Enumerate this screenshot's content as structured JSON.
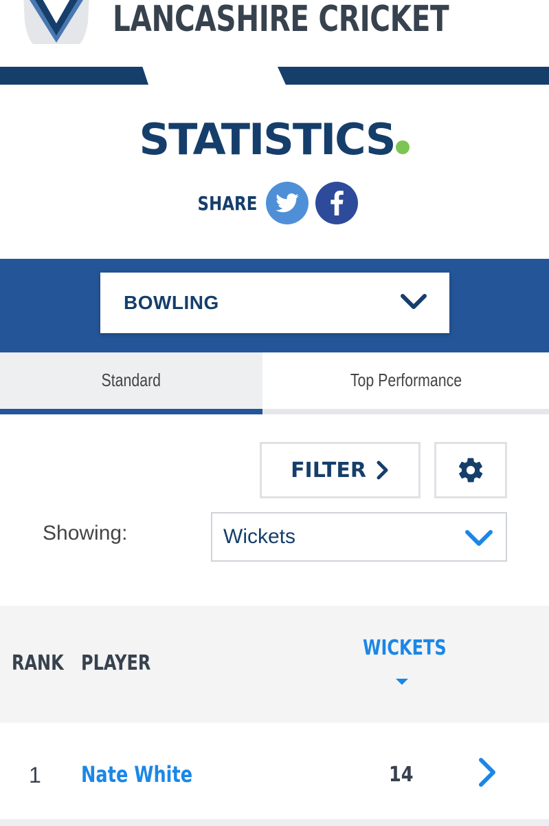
{
  "header": {
    "brand": "LANCASHIRE CRICKET",
    "logo_icon": "cricket-shirt-icon"
  },
  "page": {
    "title": "STATISTICS",
    "accent_dot_color": "#7cc552"
  },
  "share": {
    "label": "SHARE",
    "twitter_icon": "twitter-icon",
    "facebook_icon": "facebook-icon"
  },
  "category_select": {
    "value": "BOWLING"
  },
  "tabs": [
    {
      "label": "Standard",
      "active": true
    },
    {
      "label": "Top Performance",
      "active": false
    }
  ],
  "toolbar": {
    "filter_label": "FILTER",
    "settings_icon": "gear-icon"
  },
  "showing": {
    "label": "Showing:",
    "value": "Wickets"
  },
  "table": {
    "columns": [
      "RANK",
      "PLAYER",
      "WICKETS"
    ],
    "sorted_column": "WICKETS",
    "rows": [
      {
        "rank": "1",
        "player": "Nate White",
        "value": "14"
      }
    ]
  },
  "colors": {
    "navy": "#153e6b",
    "band_blue": "#245598",
    "link_blue": "#1b87e6",
    "twitter_blue": "#4f8fd8",
    "facebook_blue": "#2d4b9a"
  }
}
